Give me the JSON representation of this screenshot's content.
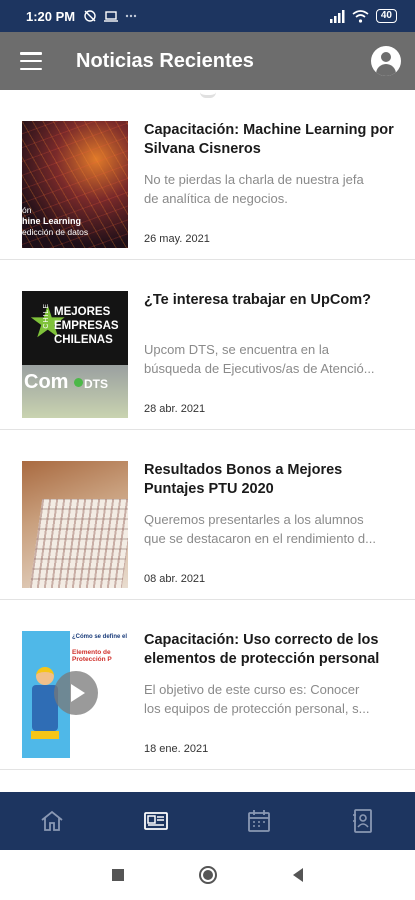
{
  "status_bar": {
    "time": "1:20 PM",
    "battery": "40",
    "icons_left": [
      "alarm-off-icon",
      "laptop-icon",
      "dots-icon"
    ],
    "icons_right": [
      "signal-icon",
      "wifi-icon",
      "battery-icon"
    ]
  },
  "app_bar": {
    "title": "Noticias Recientes",
    "menu_icon": "menu-icon",
    "profile_icon": "account-circle-icon"
  },
  "news": [
    {
      "title": "Capacitación: Machine Learning por Silvana Cisneros",
      "summary_lines": [
        "No te pierdas la charla de nuestra jefa",
        "de analítica de negocios."
      ],
      "date": "26 may. 2021",
      "thumb_caption_1": "ón",
      "thumb_caption_2": "hine Learning",
      "thumb_caption_3": "edicción de datos"
    },
    {
      "title": "¿Te interesa trabajar en UpCom?",
      "summary_lines": [
        "Upcom DTS, se encuentra en la",
        "búsqueda de Ejecutivos/as de Atenció..."
      ],
      "date": "28 abr. 2021",
      "thumb_chile": "CHILE",
      "thumb_mejores": "MEJORES",
      "thumb_empresas": "EMPRESAS",
      "thumb_chilenas": "CHILENAS",
      "thumb_com": "Com",
      "thumb_dts": "DTS"
    },
    {
      "title": "Resultados Bonos a Mejores Puntajes PTU 2020",
      "summary_lines": [
        "Queremos presentarles a los alumnos",
        "que se destacaron en el rendimiento d..."
      ],
      "date": "08 abr. 2021"
    },
    {
      "title": "Capacitación: Uso correcto de los elementos de protección personal",
      "summary_lines": [
        "El objetivo de este curso es: Conocer",
        "los equipos de protección personal, s..."
      ],
      "date": "18 ene. 2021",
      "thumb_q": "¿Cómo se define el",
      "thumb_q2": "Elemento de Protección P"
    }
  ],
  "bottom_nav": {
    "items": [
      "home-icon",
      "news-icon",
      "calendar-icon",
      "contacts-icon"
    ],
    "active_color": "#ffffff",
    "inactive_color": "#8a98b3"
  },
  "colors": {
    "status_bar": "#1d3560",
    "app_bar": "#6d6d6d",
    "bottom_nav": "#1d3560"
  }
}
